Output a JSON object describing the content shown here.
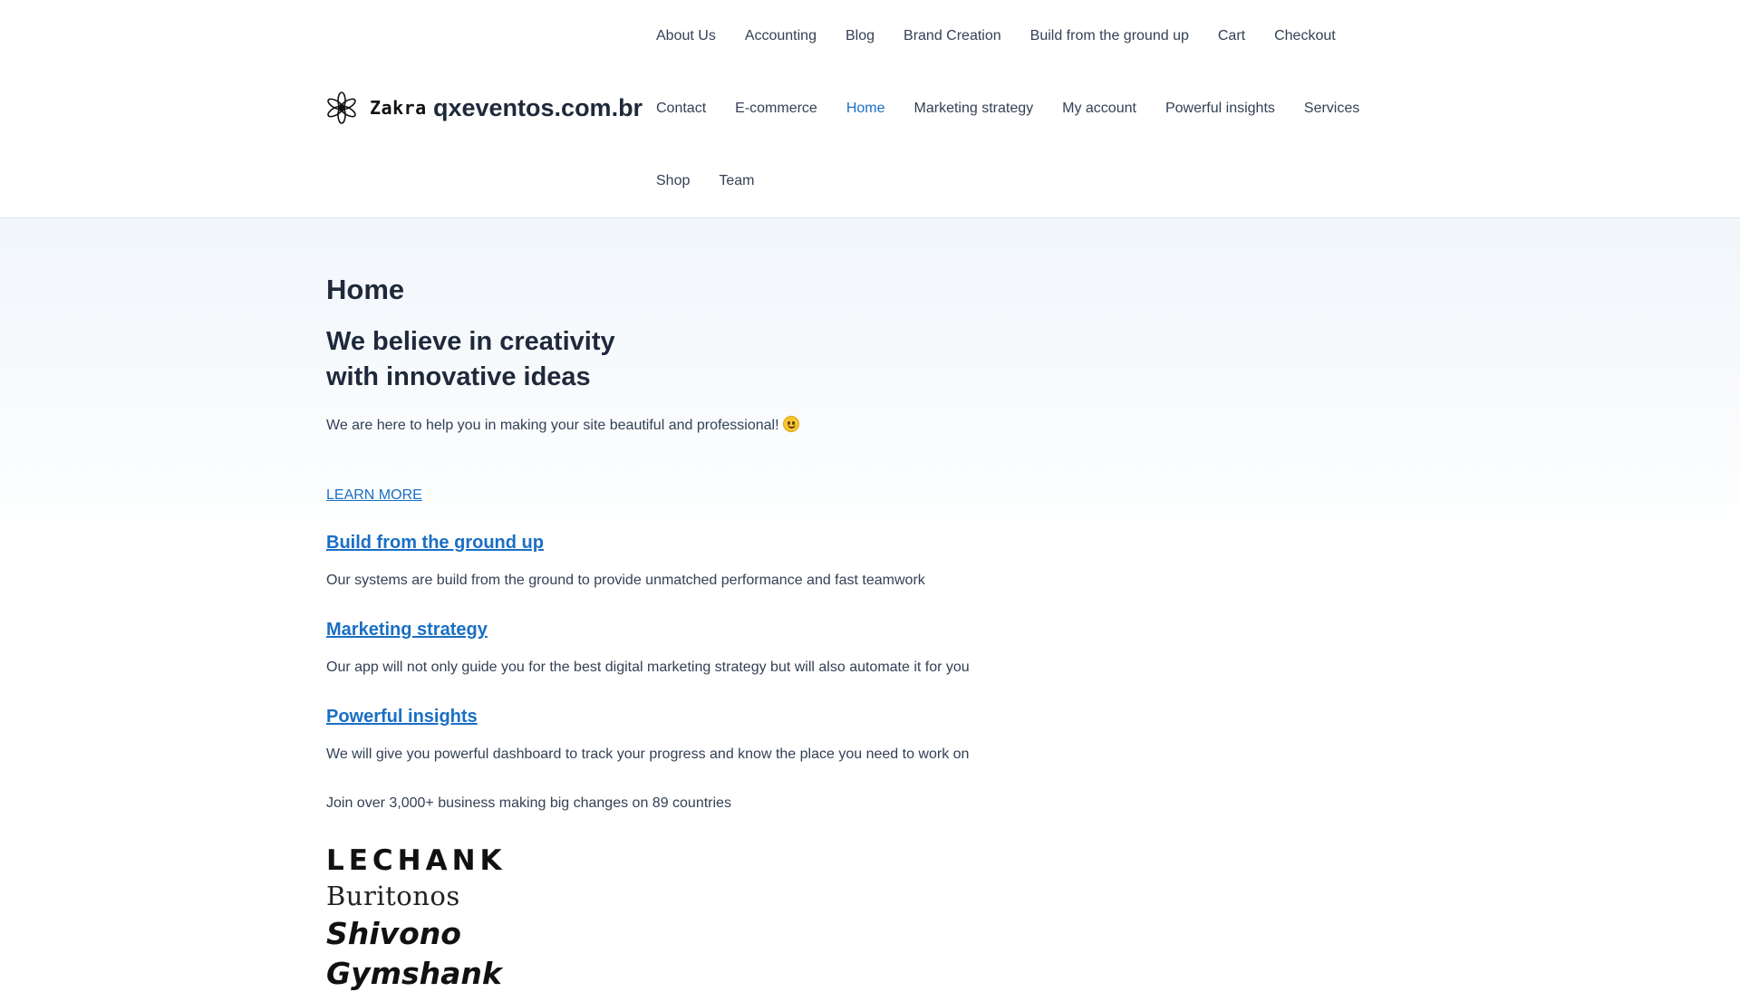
{
  "header": {
    "logo_text": "Zakra",
    "logo_icon": "flower-logo-icon",
    "site_title": "qxeventos.com.br",
    "nav": [
      {
        "label": "About Us",
        "active": false
      },
      {
        "label": "Accounting",
        "active": false
      },
      {
        "label": "Blog",
        "active": false
      },
      {
        "label": "Brand Creation",
        "active": false
      },
      {
        "label": "Build from the ground up",
        "active": false
      },
      {
        "label": "Cart",
        "active": false
      },
      {
        "label": "Checkout",
        "active": false
      },
      {
        "label": "Contact",
        "active": false
      },
      {
        "label": "E-commerce",
        "active": false
      },
      {
        "label": "Home",
        "active": true
      },
      {
        "label": "Marketing strategy",
        "active": false
      },
      {
        "label": "My account",
        "active": false
      },
      {
        "label": "Powerful insights",
        "active": false
      },
      {
        "label": "Services",
        "active": false
      },
      {
        "label": "Shop",
        "active": false
      },
      {
        "label": "Team",
        "active": false
      }
    ]
  },
  "main": {
    "page_title": "Home",
    "hero": {
      "heading_lines": [
        "We believe in creativity",
        "with innovative ideas"
      ],
      "text": "We are here to help you in making your site beautiful and professional!",
      "emoji": "slightly-smiling-face-icon",
      "cta": "LEARN MORE"
    },
    "features": [
      {
        "title": "Build from the ground up",
        "description": "Our systems are build from the ground to provide unmatched performance and fast teamwork"
      },
      {
        "title": "Marketing strategy",
        "description": "Our app will not only guide you for the best digital marketing strategy but will also automate it for you"
      },
      {
        "title": "Powerful insights",
        "description": "We will give you powerful dashboard to track your progress and know the place you need to work on"
      }
    ],
    "join_text": "Join over 3,000+ business making big changes on 89 countries",
    "client_logos": [
      "LECHANK",
      "Buritonos",
      "Shivono",
      "Gymshank"
    ]
  },
  "colors": {
    "accent": "#1a6fc4",
    "text": "#1e293b",
    "muted_text": "#334155",
    "header_border": "#dbe3ec",
    "hero_bg": "#f1f6fb"
  }
}
